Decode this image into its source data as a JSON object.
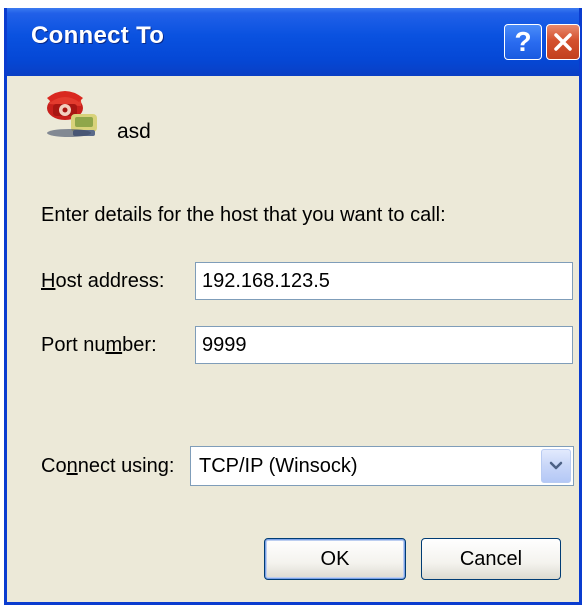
{
  "window": {
    "title": "Connect To",
    "help_glyph": "?",
    "close_glyph": "×"
  },
  "session": {
    "name": "asd",
    "icon": "telephone-connection-icon"
  },
  "instructions": "Enter details for the host that you want to call:",
  "host_address": {
    "label_pre": "",
    "label_key": "H",
    "label_post": "ost address:",
    "value": "192.168.123.5"
  },
  "port_number": {
    "label_pre": "Port nu",
    "label_key": "m",
    "label_post": "ber:",
    "value": "9999"
  },
  "connect_using": {
    "label_pre": "Co",
    "label_key": "n",
    "label_post": "nect using:",
    "selected": "TCP/IP (Winsock)"
  },
  "buttons": {
    "ok": "OK",
    "cancel": "Cancel"
  },
  "colors": {
    "titlebar": "#0548d6",
    "dialog_background": "#ece9d8",
    "close_button": "#d4512e"
  }
}
